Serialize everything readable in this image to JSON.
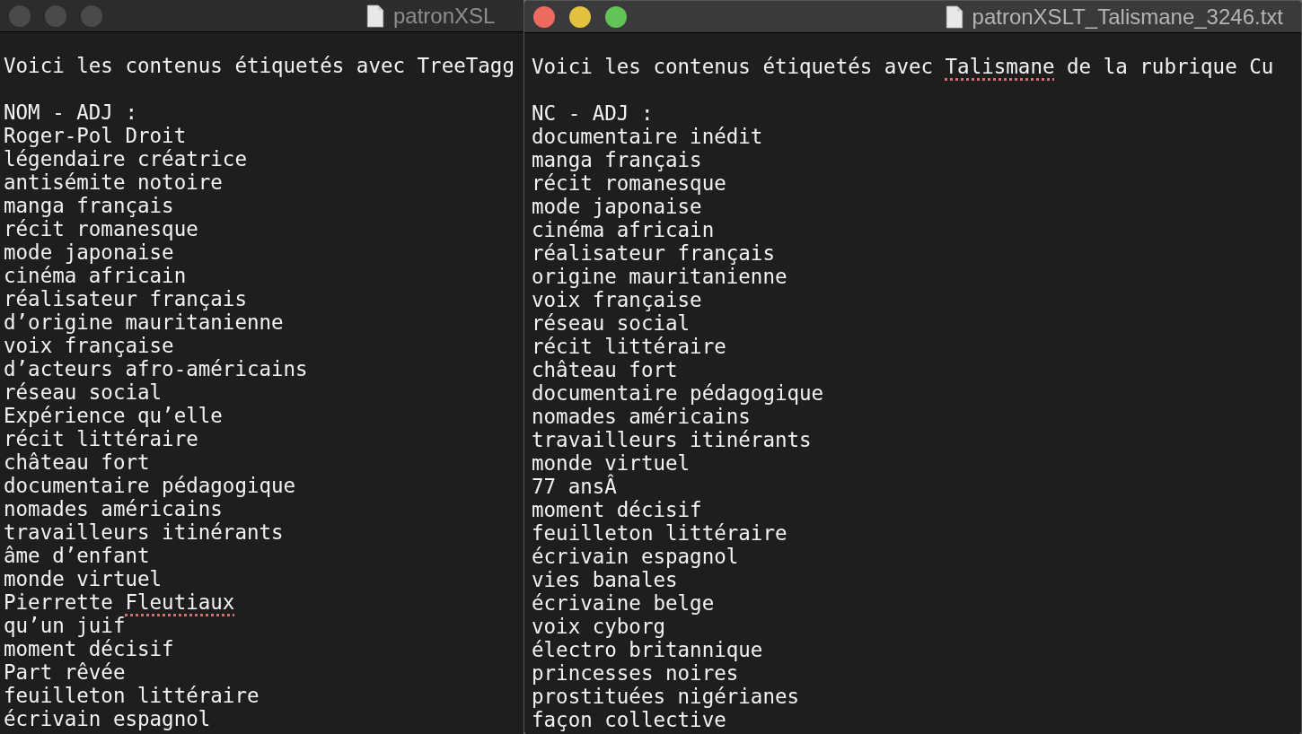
{
  "windows": [
    {
      "title": "patronXSL",
      "active": false,
      "lines": [
        {
          "text": "Voici les contenus étiquetés avec TreeTagg"
        },
        {
          "text": "NOM - ADJ :"
        },
        {
          "text": "Roger-Pol Droit"
        },
        {
          "text": "légendaire créatrice"
        },
        {
          "text": "antisémite notoire"
        },
        {
          "text": "manga français"
        },
        {
          "text": "récit romanesque"
        },
        {
          "text": "mode japonaise"
        },
        {
          "text": "cinéma africain"
        },
        {
          "text": "réalisateur français"
        },
        {
          "text": "d’origine mauritanienne"
        },
        {
          "text": "voix française"
        },
        {
          "text": "d’acteurs afro-américains"
        },
        {
          "text": "réseau social"
        },
        {
          "text": "Expérience qu’elle"
        },
        {
          "text": "récit littéraire"
        },
        {
          "text": "château fort"
        },
        {
          "text": "documentaire pédagogique"
        },
        {
          "text": "nomades américains"
        },
        {
          "text": "travailleurs itinérants"
        },
        {
          "text": "âme d’enfant"
        },
        {
          "text": "monde virtuel"
        },
        {
          "text": "Pierrette ",
          "flagged": "Fleutiaux"
        },
        {
          "text": "qu’un juif"
        },
        {
          "text": "moment décisif"
        },
        {
          "text": "Part rêvée"
        },
        {
          "text": "feuilleton littéraire"
        },
        {
          "text": "écrivain espagnol"
        }
      ]
    },
    {
      "title": "patronXSLT_Talismane_3246.txt",
      "active": true,
      "lines": [
        {
          "text": "Voici les contenus étiquetés avec ",
          "flagged": "Talismane",
          "rest": " de la rubrique Cu"
        },
        {
          "text": "NC - ADJ :"
        },
        {
          "text": "documentaire inédit"
        },
        {
          "text": "manga français"
        },
        {
          "text": "récit romanesque"
        },
        {
          "text": "mode japonaise"
        },
        {
          "text": "cinéma africain"
        },
        {
          "text": "réalisateur français"
        },
        {
          "text": "origine mauritanienne"
        },
        {
          "text": "voix française"
        },
        {
          "text": "réseau social"
        },
        {
          "text": "récit littéraire"
        },
        {
          "text": "château fort"
        },
        {
          "text": "documentaire pédagogique"
        },
        {
          "text": "nomades américains"
        },
        {
          "text": "travailleurs itinérants"
        },
        {
          "text": "monde virtuel"
        },
        {
          "text": "77 ansÂ"
        },
        {
          "text": "moment décisif"
        },
        {
          "text": "feuilleton littéraire"
        },
        {
          "text": "écrivain espagnol"
        },
        {
          "text": "vies banales"
        },
        {
          "text": "écrivaine belge"
        },
        {
          "text": "voix cyborg"
        },
        {
          "text": "électro britannique"
        },
        {
          "text": "princesses noires"
        },
        {
          "text": "prostituées nigérianes"
        },
        {
          "text": "façon collective"
        }
      ]
    }
  ]
}
